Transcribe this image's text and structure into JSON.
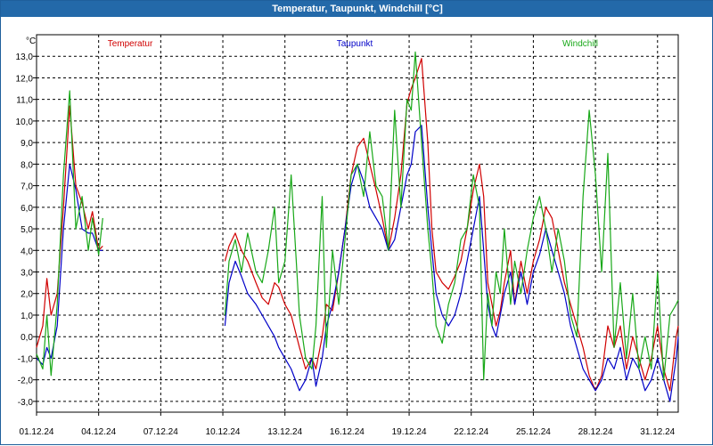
{
  "window": {
    "title": "Temperatur, Taupunkt, Windchill [°C]"
  },
  "colors": {
    "titlebar": "#2369a9",
    "grid": "#000000"
  },
  "chart_data": {
    "type": "line",
    "title": "Temperatur, Taupunkt, Windchill [°C]",
    "ylabel": "°C",
    "xlabel": "",
    "ylim": [
      -3.5,
      14.0
    ],
    "xlim": [
      0,
      31
    ],
    "grid": true,
    "x_tick_labels": [
      "01.12.24",
      "04.12.24",
      "07.12.24",
      "10.12.24",
      "13.12.24",
      "16.12.24",
      "19.12.24",
      "22.12.24",
      "25.12.24",
      "28.12.24",
      "31.12.24"
    ],
    "y_tick_labels": [
      "13,0",
      "12,0",
      "11,0",
      "10,0",
      "9,0",
      "8,0",
      "7,0",
      "6,0",
      "5,0",
      "4,0",
      "3,0",
      "2,0",
      "1,0",
      "0,0",
      "-1,0",
      "-2,0",
      "-3,0"
    ],
    "x_unit_note": "x = days since 01.12.24 00:00",
    "series": [
      {
        "name": "Temperatur",
        "color": "#d00000",
        "x": [
          0,
          0.3,
          0.5,
          0.7,
          1.0,
          1.3,
          1.6,
          1.9,
          2.2,
          2.5,
          2.7,
          3.0,
          3.2,
          null,
          9.1,
          9.3,
          9.6,
          9.9,
          10.2,
          10.6,
          10.9,
          11.2,
          11.5,
          11.7,
          12.0,
          12.3,
          12.7,
          13.0,
          13.3,
          13.5,
          13.8,
          14.0,
          14.3,
          14.6,
          14.9,
          15.2,
          15.5,
          15.8,
          16.1,
          16.4,
          16.7,
          17.0,
          17.3,
          17.6,
          17.9,
          18.1,
          18.3,
          18.6,
          18.9,
          19.1,
          19.3,
          19.6,
          19.9,
          20.2,
          20.5,
          20.8,
          21.1,
          21.4,
          21.6,
          21.8,
          22.0,
          22.2,
          22.4,
          22.6,
          22.9,
          23.1,
          23.4,
          23.7,
          24.0,
          24.3,
          24.6,
          24.9,
          25.2,
          25.5,
          25.8,
          26.1,
          26.4,
          26.7,
          27.0,
          27.3,
          27.6,
          27.9,
          28.2,
          28.5,
          28.8,
          29.1,
          29.4,
          29.7,
          30.0,
          30.3,
          30.6,
          30.9,
          31.0
        ],
        "y": [
          -0.5,
          0.5,
          2.7,
          1.0,
          2.0,
          6.0,
          10.7,
          7.0,
          6.2,
          5.0,
          5.8,
          4.0,
          4.2,
          null,
          3.5,
          4.2,
          4.8,
          4.0,
          3.5,
          2.5,
          1.8,
          1.5,
          2.5,
          2.3,
          1.5,
          1.0,
          -0.5,
          -1.5,
          -1.0,
          -1.5,
          0.0,
          1.5,
          1.2,
          3.0,
          5.0,
          7.5,
          8.8,
          9.2,
          8.0,
          6.8,
          5.5,
          4.0,
          5.5,
          7.5,
          10.8,
          11.5,
          12.0,
          12.9,
          9.0,
          5.0,
          3.0,
          2.5,
          2.2,
          2.8,
          3.5,
          5.0,
          6.8,
          8.0,
          6.5,
          2.5,
          1.5,
          0.5,
          1.2,
          2.5,
          4.0,
          1.5,
          3.5,
          2.0,
          3.5,
          4.5,
          6.0,
          5.5,
          4.0,
          2.5,
          1.5,
          0.5,
          -0.5,
          -1.8,
          -2.5,
          -1.8,
          0.5,
          -0.5,
          0.5,
          -1.5,
          0.0,
          -1.0,
          -2.0,
          -1.0,
          0.5,
          -1.5,
          -2.5,
          0.0,
          0.5
        ]
      },
      {
        "name": "Taupunkt",
        "color": "#0000c8",
        "x": [
          0,
          0.3,
          0.5,
          0.7,
          1.0,
          1.3,
          1.6,
          1.9,
          2.2,
          2.5,
          2.7,
          3.0,
          3.2,
          null,
          9.1,
          9.3,
          9.6,
          9.9,
          10.2,
          10.6,
          10.9,
          11.2,
          11.5,
          11.7,
          12.0,
          12.3,
          12.7,
          13.0,
          13.3,
          13.5,
          13.8,
          14.0,
          14.3,
          14.6,
          14.9,
          15.2,
          15.5,
          15.8,
          16.1,
          16.4,
          16.7,
          17.0,
          17.3,
          17.6,
          17.9,
          18.1,
          18.3,
          18.6,
          18.9,
          19.1,
          19.3,
          19.6,
          19.9,
          20.2,
          20.5,
          20.8,
          21.1,
          21.4,
          21.6,
          21.8,
          22.0,
          22.2,
          22.4,
          22.6,
          22.9,
          23.1,
          23.4,
          23.7,
          24.0,
          24.3,
          24.6,
          24.9,
          25.2,
          25.5,
          25.8,
          26.1,
          26.4,
          26.7,
          27.0,
          27.3,
          27.6,
          27.9,
          28.2,
          28.5,
          28.8,
          29.1,
          29.4,
          29.7,
          30.0,
          30.3,
          30.6,
          30.9,
          31.0
        ],
        "y": [
          -1.0,
          -1.3,
          -0.5,
          -1.0,
          0.5,
          5.0,
          8.0,
          6.8,
          5.0,
          4.8,
          4.8,
          4.0,
          4.0,
          null,
          0.5,
          2.5,
          3.5,
          2.8,
          2.0,
          1.5,
          1.0,
          0.5,
          0.0,
          -0.5,
          -1.0,
          -1.5,
          -2.5,
          -2.0,
          -1.0,
          -2.3,
          -1.0,
          0.5,
          1.5,
          3.0,
          5.0,
          7.0,
          8.0,
          7.2,
          6.0,
          5.5,
          5.0,
          4.0,
          4.5,
          6.0,
          7.5,
          8.0,
          9.5,
          9.8,
          6.0,
          4.0,
          2.0,
          1.0,
          0.5,
          1.0,
          2.0,
          3.5,
          5.0,
          6.5,
          4.0,
          1.5,
          0.5,
          0.0,
          1.0,
          2.0,
          3.0,
          1.5,
          3.0,
          1.5,
          3.0,
          3.8,
          5.0,
          4.0,
          3.0,
          2.0,
          0.5,
          -0.5,
          -1.5,
          -2.0,
          -2.5,
          -2.0,
          -1.0,
          -1.5,
          -0.5,
          -2.0,
          -1.0,
          -1.5,
          -2.5,
          -2.0,
          -1.0,
          -2.0,
          -3.0,
          -1.0,
          0.0
        ]
      },
      {
        "name": "Windchill",
        "color": "#18a818",
        "x": [
          0,
          0.3,
          0.5,
          0.7,
          1.0,
          1.3,
          1.6,
          1.9,
          2.2,
          2.5,
          2.7,
          3.0,
          3.2,
          null,
          9.1,
          9.3,
          9.6,
          9.9,
          10.2,
          10.6,
          10.9,
          11.2,
          11.5,
          11.7,
          12.0,
          12.3,
          12.7,
          13.0,
          13.3,
          13.5,
          13.8,
          14.0,
          14.3,
          14.6,
          14.9,
          15.2,
          15.5,
          15.8,
          16.1,
          16.4,
          16.7,
          17.0,
          17.3,
          17.6,
          17.9,
          18.1,
          18.3,
          18.6,
          18.9,
          19.1,
          19.3,
          19.6,
          19.9,
          20.2,
          20.5,
          20.8,
          21.1,
          21.4,
          21.6,
          21.8,
          22.0,
          22.2,
          22.4,
          22.6,
          22.9,
          23.1,
          23.4,
          23.7,
          24.0,
          24.3,
          24.6,
          24.9,
          25.2,
          25.5,
          25.8,
          26.1,
          26.4,
          26.7,
          27.0,
          27.3,
          27.6,
          27.9,
          28.2,
          28.5,
          28.8,
          29.1,
          29.4,
          29.7,
          30.0,
          30.3,
          30.6,
          30.9,
          31.0
        ],
        "y": [
          -0.8,
          -1.5,
          1.0,
          -1.8,
          1.5,
          7.5,
          11.4,
          5.0,
          6.5,
          4.0,
          5.5,
          3.8,
          5.5,
          null,
          1.0,
          3.5,
          4.5,
          3.0,
          4.8,
          3.0,
          2.5,
          4.0,
          6.0,
          2.5,
          3.5,
          7.5,
          1.0,
          -1.0,
          -1.5,
          0.5,
          6.5,
          -0.5,
          4.0,
          1.5,
          4.5,
          7.5,
          8.0,
          6.5,
          9.5,
          7.0,
          6.5,
          4.0,
          10.5,
          6.0,
          11.0,
          10.5,
          13.2,
          9.0,
          5.0,
          3.0,
          0.5,
          -0.3,
          1.5,
          2.5,
          4.5,
          5.0,
          7.5,
          6.0,
          -2.0,
          2.0,
          0.5,
          3.0,
          2.0,
          5.0,
          1.5,
          3.5,
          2.0,
          4.0,
          5.5,
          6.5,
          5.0,
          3.0,
          5.0,
          3.5,
          1.0,
          0.0,
          6.5,
          10.5,
          7.5,
          3.0,
          8.5,
          -0.5,
          2.5,
          -1.0,
          2.0,
          -1.5,
          0.0,
          -1.5,
          3.0,
          -2.0,
          1.0,
          1.5,
          1.7
        ]
      }
    ]
  }
}
